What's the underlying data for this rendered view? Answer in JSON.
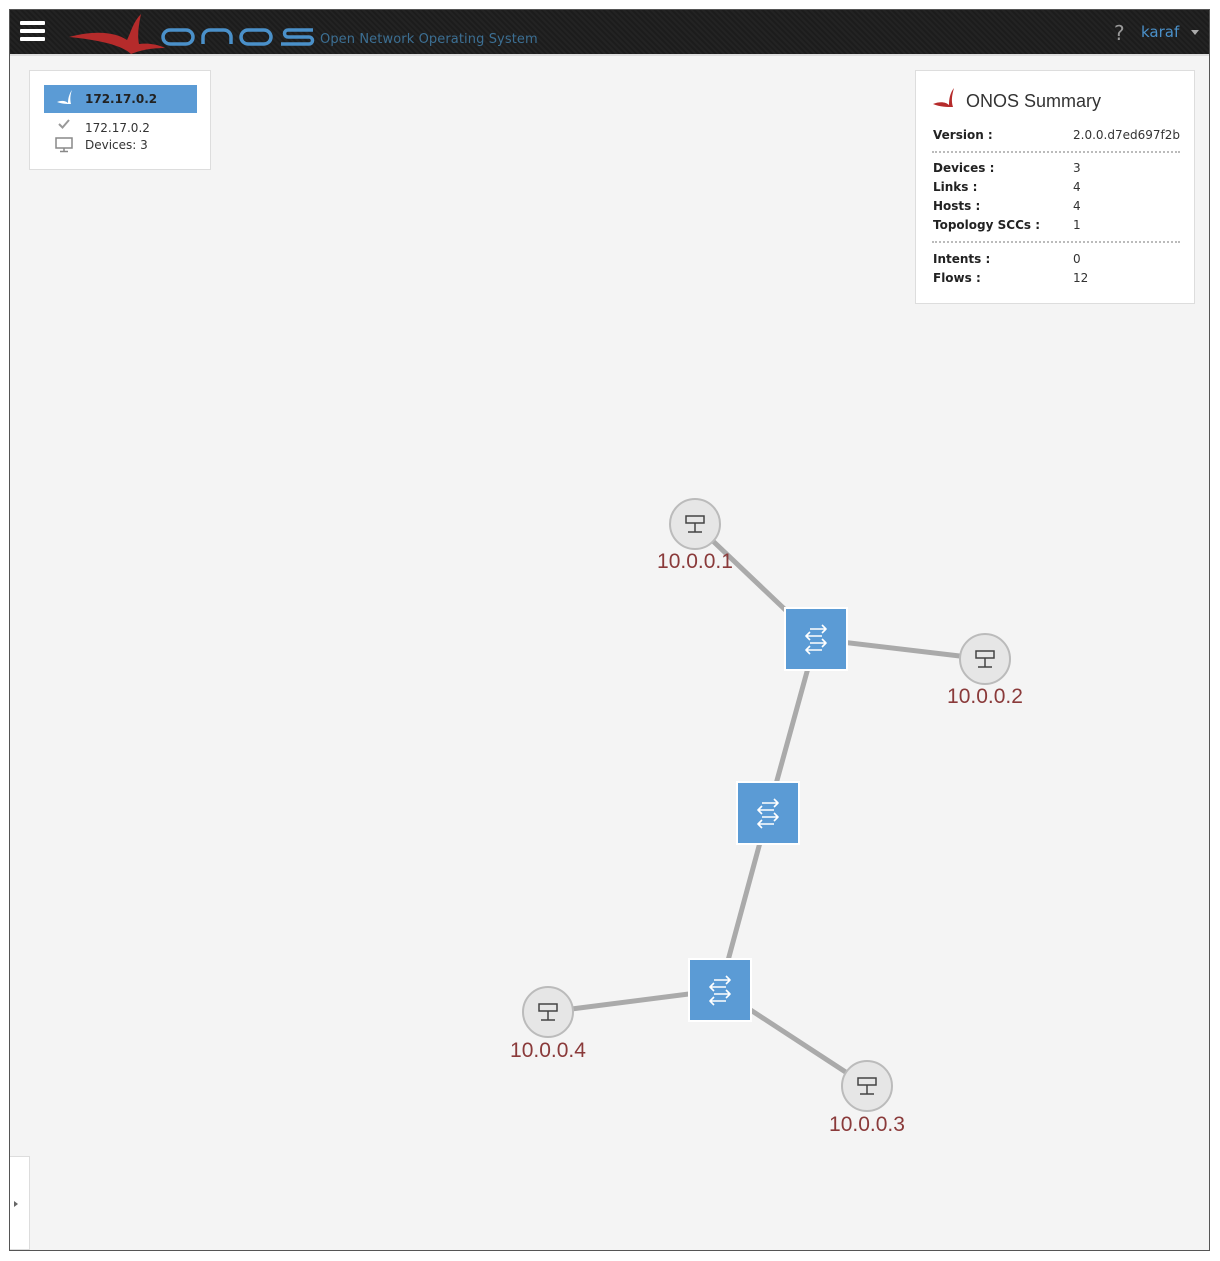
{
  "header": {
    "app_subtitle": "Open Network Operating System",
    "help_label": "?",
    "user": "karaf",
    "icons": [
      "menu-icon",
      "onos-logo",
      "help-icon",
      "chevron-down-icon"
    ]
  },
  "instance_panel": {
    "header_label": "172.17.0.2",
    "ip": "172.17.0.2",
    "devices": "Devices: 3"
  },
  "summary": {
    "title": "ONOS Summary",
    "version_label": "Version :",
    "version": "2.0.0.d7ed697f2b",
    "devices_label": "Devices :",
    "devices": "3",
    "links_label": "Links :",
    "links": "4",
    "hosts_label": "Hosts :",
    "hosts": "4",
    "sccs_label": "Topology SCCs :",
    "sccs": "1",
    "intents_label": "Intents :",
    "intents": "0",
    "flows_label": "Flows :",
    "flows": "12"
  },
  "topology": {
    "hosts": [
      "10.0.0.1",
      "10.0.0.2",
      "10.0.0.4",
      "10.0.0.3"
    ],
    "switch_count": 3,
    "colors": {
      "switch": "#5b9bd5",
      "host_label": "#8a3a3a",
      "link": "#aaaaaa",
      "logo_red": "#b52b2b",
      "logo_blue": "#4a90c9"
    }
  }
}
